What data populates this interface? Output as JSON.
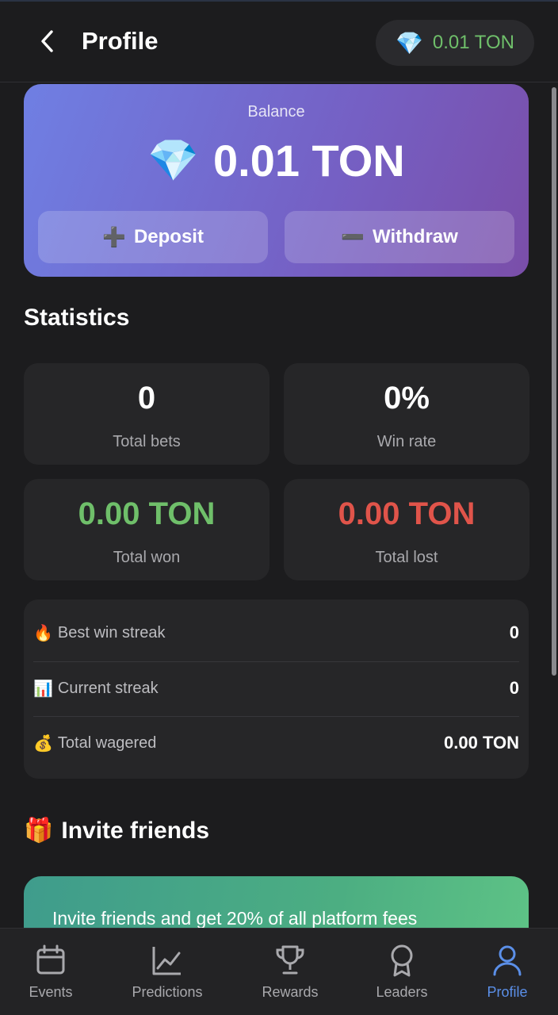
{
  "header": {
    "title": "Profile",
    "balance": "0.01 TON"
  },
  "balance_card": {
    "label": "Balance",
    "value": "0.01 TON",
    "deposit_label": "Deposit",
    "withdraw_label": "Withdraw"
  },
  "statistics": {
    "title": "Statistics",
    "cards": [
      {
        "value": "0",
        "label": "Total bets"
      },
      {
        "value": "0%",
        "label": "Win rate"
      },
      {
        "value": "0.00 TON",
        "label": "Total won"
      },
      {
        "value": "0.00 TON",
        "label": "Total lost"
      }
    ],
    "rows": [
      {
        "emoji": "🔥",
        "label": "Best win streak",
        "value": "0"
      },
      {
        "emoji": "📊",
        "label": "Current streak",
        "value": "0"
      },
      {
        "emoji": "💰",
        "label": "Total wagered",
        "value": "0.00 TON"
      }
    ]
  },
  "invite": {
    "emoji": "🎁",
    "title": "Invite friends",
    "text": "Invite friends and get 20% of all platform fees"
  },
  "nav": {
    "items": [
      {
        "label": "Events"
      },
      {
        "label": "Predictions"
      },
      {
        "label": "Rewards"
      },
      {
        "label": "Leaders"
      },
      {
        "label": "Profile"
      }
    ]
  },
  "colors": {
    "accent": "#5b8fe8",
    "won": "#6fbf6a",
    "lost": "#e0544a"
  }
}
